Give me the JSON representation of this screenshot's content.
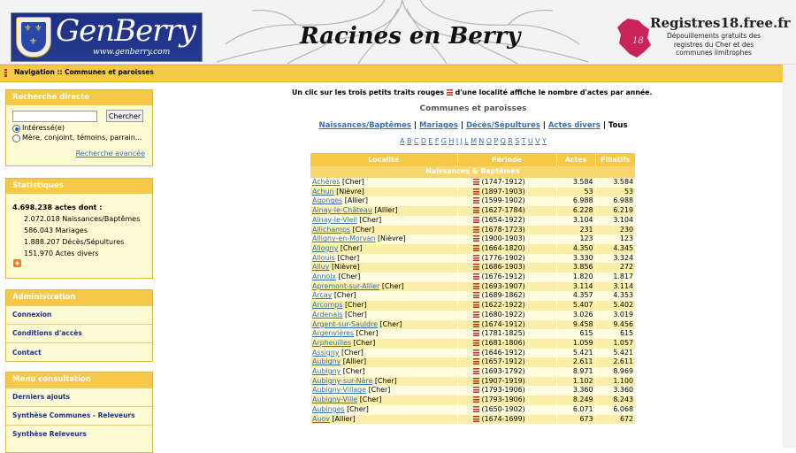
{
  "header": {
    "logo_text": "GenBerry",
    "logo_url": "www.genberry.com",
    "site_title": "Racines en Berry",
    "partner_title": "Registres18.free.fr",
    "partner_subtitle": "Dépouillements gratuits des registres du Cher et des communes limitrophes",
    "partner_badge": "18"
  },
  "navbar": {
    "breadcrumb": "Navigation :: Communes et paroisses"
  },
  "search": {
    "title": "Recherche directe",
    "button": "Chercher",
    "input_value": "",
    "option1": "Intéressé(e)",
    "option2": "Mère, conjoint, témoins, parrain...",
    "advanced_link": "Recherche avancée"
  },
  "stats": {
    "title": "Statistiques",
    "total": "4.698.238 actes dont :",
    "items": [
      "2.072.018 Naissances/Baptêmes",
      "586.043 Mariages",
      "1.888.207 Décès/Sépultures",
      "151.970 Actes divers"
    ]
  },
  "admin": {
    "title": "Administration",
    "items": [
      "Connexion",
      "Conditions d'accès",
      "Contact"
    ]
  },
  "menu": {
    "title": "Menu consultation",
    "items": [
      "Derniers ajouts",
      "Synthèse Communes - Releveurs",
      "Synthèse Releveurs"
    ]
  },
  "main": {
    "intro_before": "Un clic sur les trois petits traits rouges",
    "intro_after": "d'une localité affiche le nombre d'actes par année.",
    "section_title": "Communes et paroisses",
    "tabs": [
      "Naissances/Baptêmes",
      "Mariages",
      "Décès/Sépultures",
      "Actes divers",
      "Tous"
    ],
    "alphabet": [
      "A",
      "B",
      "C",
      "D",
      "E",
      "F",
      "G",
      "H",
      "I",
      "J",
      "L",
      "M",
      "N",
      "O",
      "P",
      "Q",
      "R",
      "S",
      "T",
      "U",
      "V",
      "Y"
    ],
    "columns": [
      "Localité",
      "Période",
      "Actes",
      "Filiatifs"
    ],
    "group_label": "Naissances & Baptêmes",
    "rows": [
      {
        "name": "Achères",
        "dept": "[Cher]",
        "period": "(1747-1912)",
        "actes": "3.584",
        "filiatifs": "3.584"
      },
      {
        "name": "Achun",
        "dept": "[Nièvre]",
        "period": "(1897-1903)",
        "actes": "53",
        "filiatifs": "53"
      },
      {
        "name": "Agonges",
        "dept": "[Allier]",
        "period": "(1599-1902)",
        "actes": "6.988",
        "filiatifs": "6.988"
      },
      {
        "name": "Ainay-le-Château",
        "dept": "[Allier]",
        "period": "(1627-1784)",
        "actes": "6.228",
        "filiatifs": "6.219"
      },
      {
        "name": "Ainay-le-Vieil",
        "dept": "[Cher]",
        "period": "(1654-1922)",
        "actes": "3.104",
        "filiatifs": "3.104"
      },
      {
        "name": "Allichamps",
        "dept": "[Cher]",
        "period": "(1678-1723)",
        "actes": "231",
        "filiatifs": "230"
      },
      {
        "name": "Alligny-en-Morvan",
        "dept": "[Nièvre]",
        "period": "(1900-1903)",
        "actes": "123",
        "filiatifs": "123"
      },
      {
        "name": "Allogny",
        "dept": "[Cher]",
        "period": "(1664-1820)",
        "actes": "4.350",
        "filiatifs": "4.345"
      },
      {
        "name": "Allouis",
        "dept": "[Cher]",
        "period": "(1776-1902)",
        "actes": "3.330",
        "filiatifs": "3.324"
      },
      {
        "name": "Alluy",
        "dept": "[Nièvre]",
        "period": "(1686-1903)",
        "actes": "3.856",
        "filiatifs": "272"
      },
      {
        "name": "Annoix",
        "dept": "[Cher]",
        "period": "(1676-1912)",
        "actes": "1.820",
        "filiatifs": "1.817"
      },
      {
        "name": "Apremont-sur-Allier",
        "dept": "[Cher]",
        "period": "(1693-1907)",
        "actes": "3.114",
        "filiatifs": "3.114"
      },
      {
        "name": "Arçay",
        "dept": "[Cher]",
        "period": "(1689-1862)",
        "actes": "4.357",
        "filiatifs": "4.353"
      },
      {
        "name": "Arcomps",
        "dept": "[Cher]",
        "period": "(1622-1922)",
        "actes": "5.407",
        "filiatifs": "5.402"
      },
      {
        "name": "Ardenais",
        "dept": "[Cher]",
        "period": "(1680-1922)",
        "actes": "3.026",
        "filiatifs": "3.019"
      },
      {
        "name": "Argent-sur-Sauldre",
        "dept": "[Cher]",
        "period": "(1674-1912)",
        "actes": "9.458",
        "filiatifs": "9.456"
      },
      {
        "name": "Argenvières",
        "dept": "[Cher]",
        "period": "(1781-1825)",
        "actes": "615",
        "filiatifs": "615"
      },
      {
        "name": "Arpheuilles",
        "dept": "[Cher]",
        "period": "(1681-1806)",
        "actes": "1.059",
        "filiatifs": "1.057"
      },
      {
        "name": "Assigny",
        "dept": "[Cher]",
        "period": "(1646-1912)",
        "actes": "5.421",
        "filiatifs": "5.421"
      },
      {
        "name": "Aubigny",
        "dept": "[Allier]",
        "period": "(1657-1912)",
        "actes": "2.611",
        "filiatifs": "2.611"
      },
      {
        "name": "Aubigny",
        "dept": "[Cher]",
        "period": "(1693-1792)",
        "actes": "8.971",
        "filiatifs": "8.969"
      },
      {
        "name": "Aubigny-sur-Nère",
        "dept": "[Cher]",
        "period": "(1907-1919)",
        "actes": "1.102",
        "filiatifs": "1.100"
      },
      {
        "name": "Aubigny-Village",
        "dept": "[Cher]",
        "period": "(1793-1906)",
        "actes": "3.360",
        "filiatifs": "3.360"
      },
      {
        "name": "Aubigny-Ville",
        "dept": "[Cher]",
        "period": "(1793-1906)",
        "actes": "8.249",
        "filiatifs": "8.243"
      },
      {
        "name": "Aubinges",
        "dept": "[Cher]",
        "period": "(1650-1902)",
        "actes": "6.071",
        "filiatifs": "6.068"
      },
      {
        "name": "Auov",
        "dept": "[Allier]",
        "period": "(1674-1699)",
        "actes": "673",
        "filiatifs": "672"
      }
    ]
  },
  "colors": {
    "accent": "#f6c847",
    "link": "#3a6fb0",
    "box_bg": "#fdfbd4",
    "row_alt": "#faeea9"
  }
}
